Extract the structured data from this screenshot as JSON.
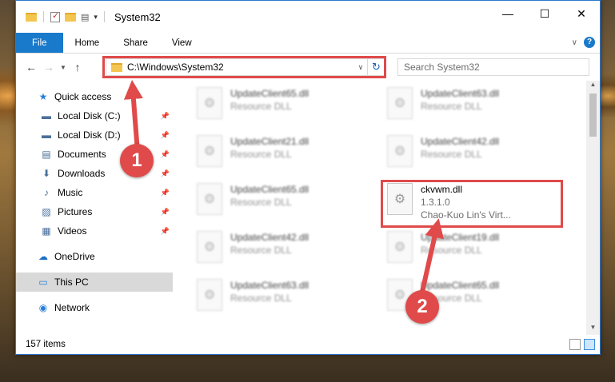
{
  "window": {
    "title": "System32",
    "controls": {
      "minimize": "—",
      "maximize": "☐",
      "close": "✕"
    }
  },
  "ribbon": {
    "tabs": [
      "File",
      "Home",
      "Share",
      "View"
    ],
    "help": "?"
  },
  "navigation": {
    "address_path": "C:\\Windows\\System32",
    "search_placeholder": "Search System32"
  },
  "sidebar": {
    "quick_access": "Quick access",
    "items": [
      {
        "label": "Local Disk (C:)",
        "icon": "drive-icon",
        "glyph": "▬"
      },
      {
        "label": "Local Disk (D:)",
        "icon": "drive-icon",
        "glyph": "▬"
      },
      {
        "label": "Documents",
        "icon": "documents-icon",
        "glyph": "▤"
      },
      {
        "label": "Downloads",
        "icon": "downloads-icon",
        "glyph": "⬇"
      },
      {
        "label": "Music",
        "icon": "music-icon",
        "glyph": "♪"
      },
      {
        "label": "Pictures",
        "icon": "pictures-icon",
        "glyph": "▨"
      },
      {
        "label": "Videos",
        "icon": "videos-icon",
        "glyph": "▦"
      }
    ],
    "onedrive": "OneDrive",
    "this_pc": "This PC",
    "network": "Network"
  },
  "files": [
    {
      "name": "UpdateClient65.dll",
      "type": "Resource DLL"
    },
    {
      "name": "UpdateClient63.dll",
      "type": "Resource DLL"
    },
    {
      "name": "UpdateClient21.dll",
      "type": "Resource DLL"
    },
    {
      "name": "UpdateClient42.dll",
      "type": "Resource DLL"
    },
    {
      "name": "UpdateClient65.dll",
      "type": "Resource DLL"
    },
    {
      "name": "ckvwm.dll",
      "version": "1.3.1.0",
      "company": "Chao-Kuo Lin's Virt..."
    },
    {
      "name": "UpdateClient42.dll",
      "type": "Resource DLL"
    },
    {
      "name": "UpdateClient19.dll",
      "type": "Resource DLL"
    },
    {
      "name": "UpdateClient63.dll",
      "type": "Resource DLL"
    },
    {
      "name": "UpdateClient65.dll",
      "type": "Resource DLL"
    }
  ],
  "status": {
    "items_count": "157 items"
  },
  "annotations": {
    "step1": "1",
    "step2": "2"
  },
  "colors": {
    "accent": "#1979ca",
    "highlight": "#e04a4a"
  }
}
